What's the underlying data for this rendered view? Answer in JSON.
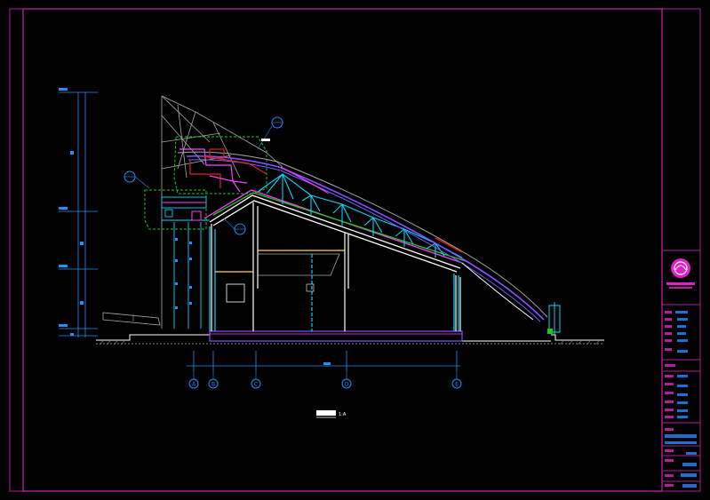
{
  "drawing": {
    "grid_axes": [
      "A",
      "B",
      "C",
      "D",
      "E"
    ],
    "caption_scale": "1:A",
    "colors": {
      "frame": "#b0209a",
      "section": "#ffffff",
      "dimension": "#1e90ff",
      "cyan": "#00d8ff",
      "magenta": "#ff40ff",
      "green": "#1ec81e",
      "red": "#e02020",
      "purple": "#8a4dff",
      "yellow": "#ffd24a",
      "title_fill": "#1e6fd0"
    }
  }
}
